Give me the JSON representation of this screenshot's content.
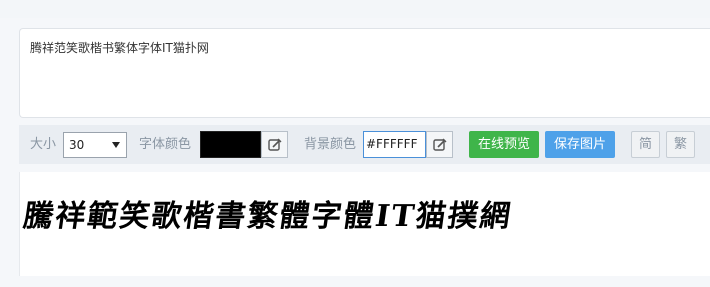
{
  "input": {
    "value": "腾祥范笑歌楷书繁体字体IT猫扑网"
  },
  "toolbar": {
    "size_label": "大小",
    "size_value": "30",
    "font_color_label": "字体颜色",
    "font_color": "#000000",
    "bg_color_label": "背景颜色",
    "bg_color_value": "#FFFFFF",
    "preview_button": "在线预览",
    "save_button": "保存图片",
    "simplified_button": "简",
    "traditional_button": "繁"
  },
  "preview": {
    "text": "騰祥範笑歌楷書繁體字體IT猫撲網"
  },
  "colors": {
    "preview_button_bg": "#3fb54a",
    "save_button_bg": "#4ea1e9"
  },
  "icons": {
    "picker": "color-picker-icon",
    "dropdown": "chevron-down-icon"
  }
}
